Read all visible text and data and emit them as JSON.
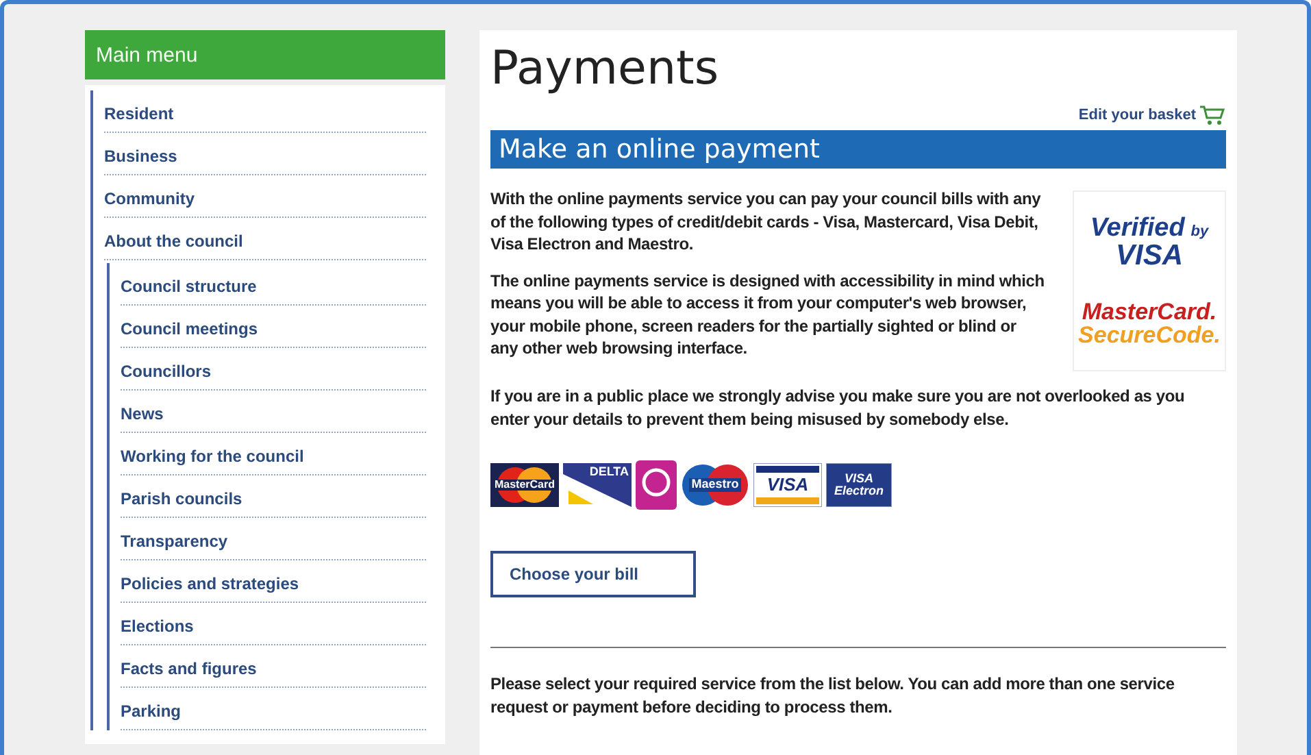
{
  "sidebar": {
    "title": "Main menu",
    "items": [
      {
        "label": "Resident"
      },
      {
        "label": "Business"
      },
      {
        "label": "Community"
      },
      {
        "label": "About the council",
        "children": [
          {
            "label": "Council structure"
          },
          {
            "label": "Council meetings"
          },
          {
            "label": "Councillors"
          },
          {
            "label": "News"
          },
          {
            "label": "Working for the council"
          },
          {
            "label": "Parish councils"
          },
          {
            "label": "Transparency"
          },
          {
            "label": "Policies and strategies"
          },
          {
            "label": "Elections"
          },
          {
            "label": "Facts and figures"
          },
          {
            "label": "Parking"
          }
        ]
      }
    ]
  },
  "main": {
    "title": "Payments",
    "basket_link": "Edit your basket",
    "section_title": "Make an online payment",
    "paragraphs": [
      "With the online payments service you can pay your council bills with any of the following types of credit/debit cards - Visa, Mastercard, Visa Debit, Visa Electron and Maestro.",
      "The online payments service is designed with accessibility in mind which means you will be able to access it from your computer's web browser, your mobile phone, screen readers for the partially sighted or blind or any other web browsing interface.",
      "If you are in a public place we strongly advise you make sure you are not overlooked as you enter your details to prevent them being misused by somebody else."
    ],
    "security_badges": [
      {
        "kind": "verified",
        "lines": [
          "Verified",
          "by",
          "VISA"
        ]
      },
      {
        "kind": "securecode",
        "lines": [
          "MasterCard.",
          "SecureCode."
        ]
      }
    ],
    "card_logos": [
      {
        "kind": "mastercard",
        "lines": [
          "MasterCard"
        ]
      },
      {
        "kind": "delta",
        "lines": [
          "DELTA"
        ]
      },
      {
        "kind": "solo"
      },
      {
        "kind": "maestro",
        "lines": [
          "Maestro"
        ]
      },
      {
        "kind": "visa",
        "lines": [
          "VISA"
        ]
      },
      {
        "kind": "electron",
        "lines": [
          "VISA",
          "Electron"
        ]
      }
    ],
    "button": "Choose your bill",
    "footer_text": "Please select your required service from the list below. You can add more than one service request or payment before deciding to process them."
  }
}
